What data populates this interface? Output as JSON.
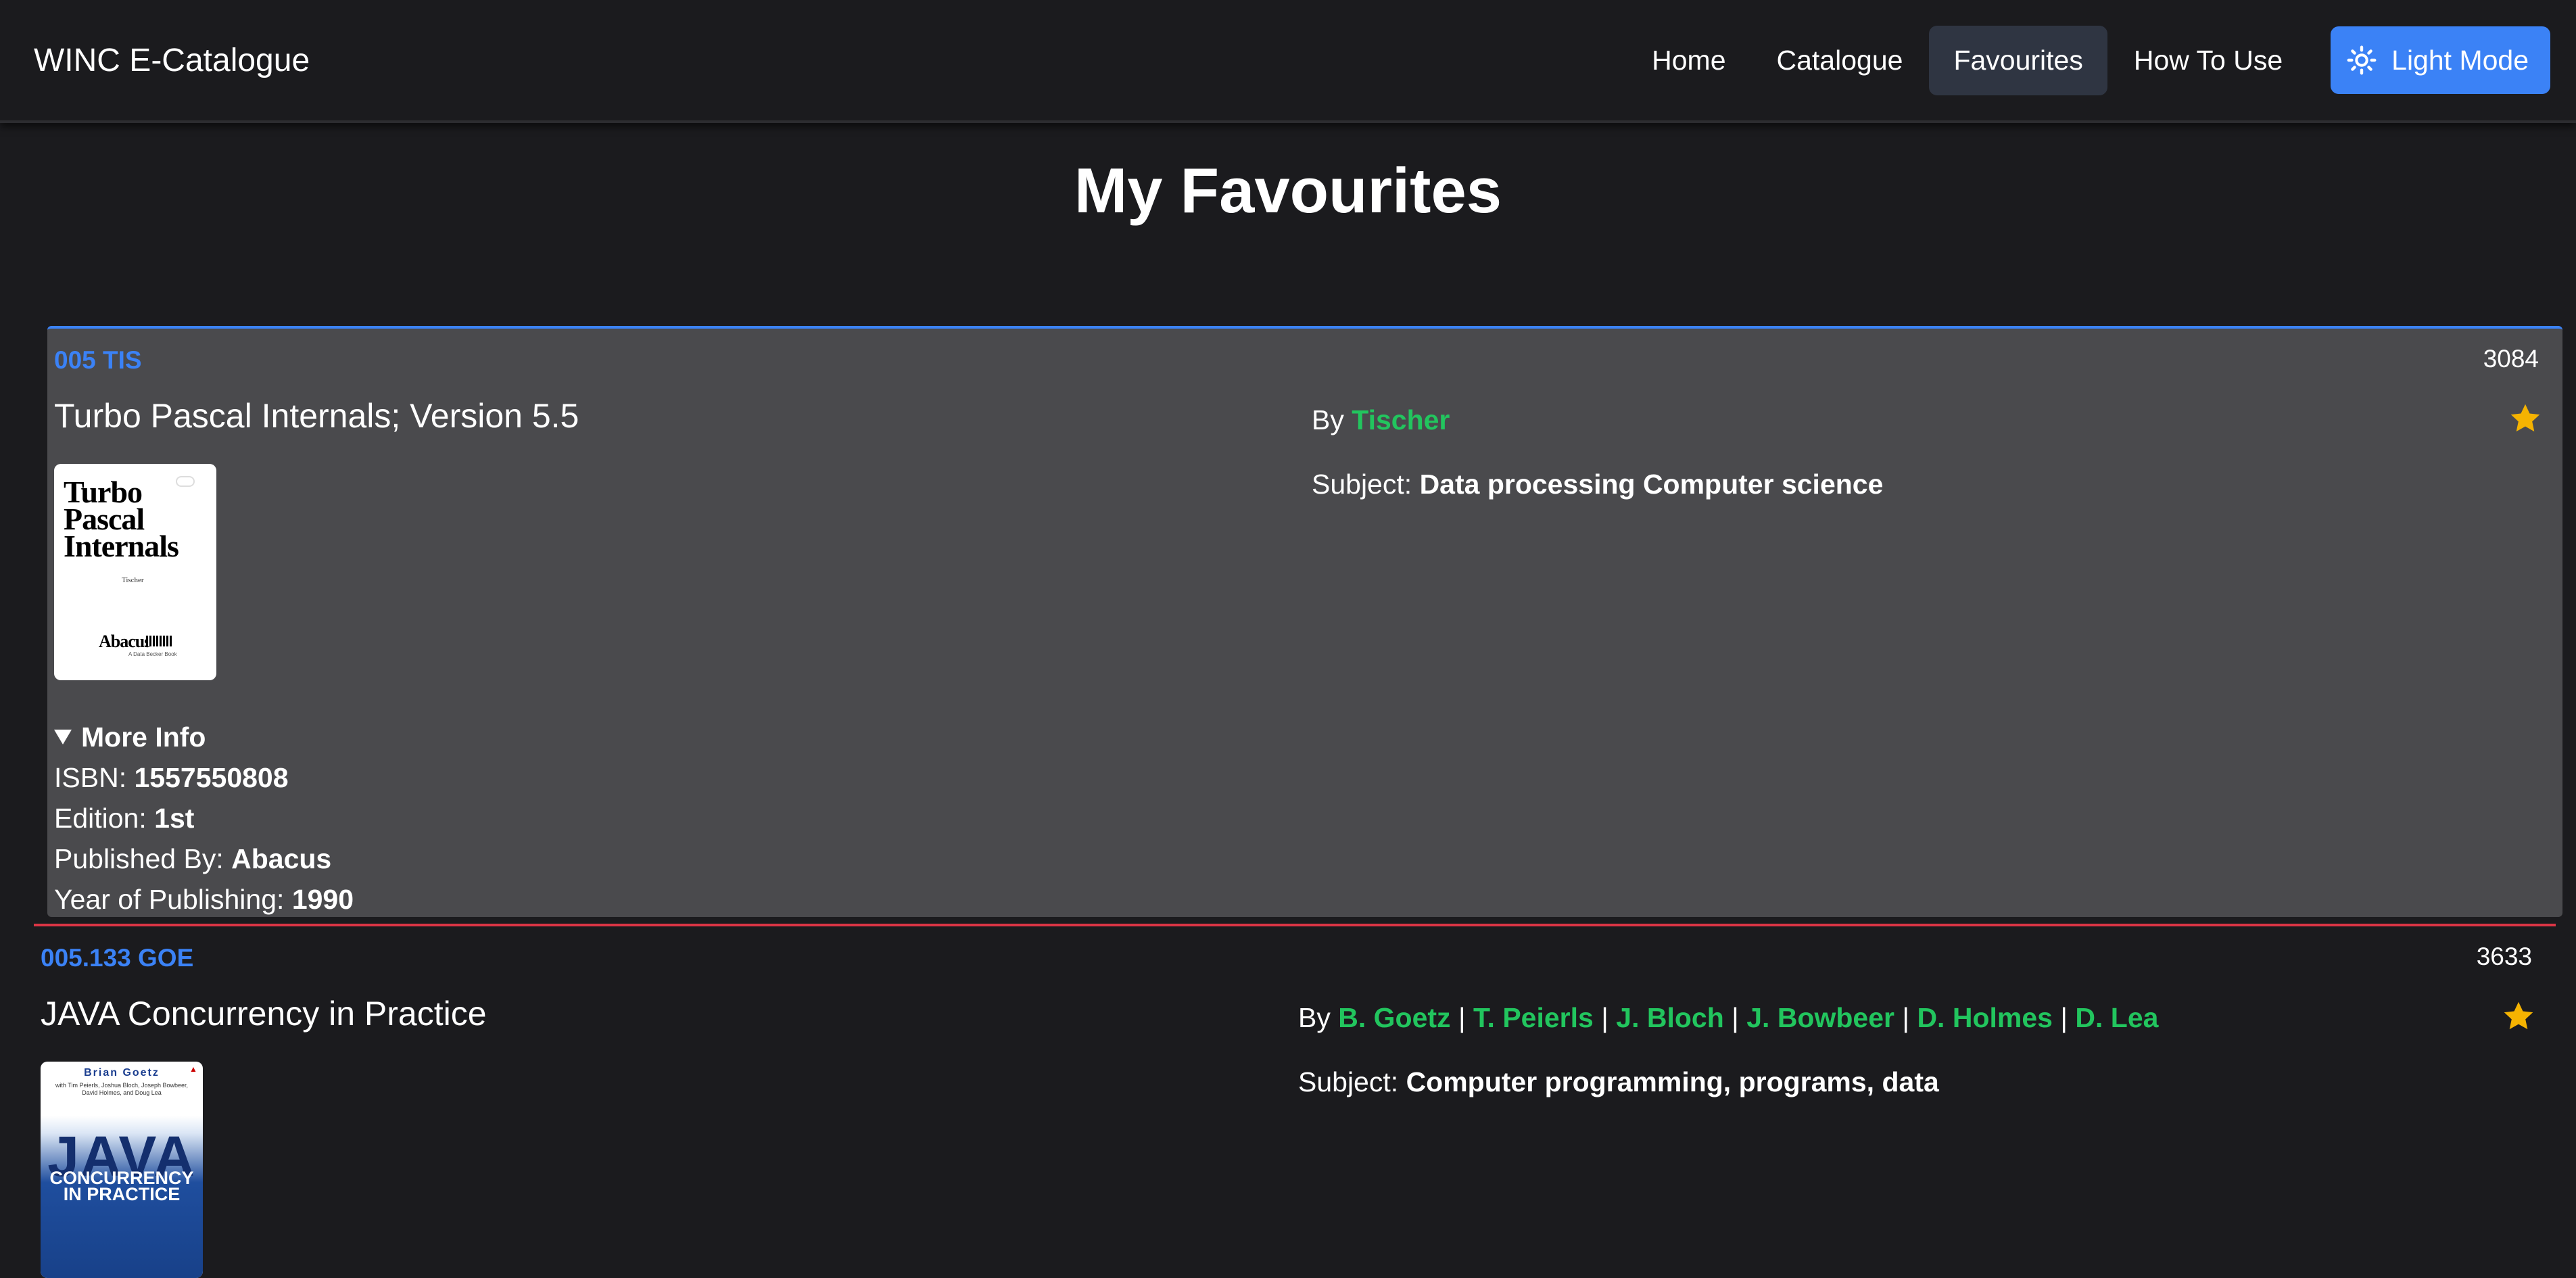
{
  "nav": {
    "brand": "WINC E-Catalogue",
    "links": [
      "Home",
      "Catalogue",
      "Favourites",
      "How To Use"
    ],
    "active": "Favourites",
    "theme_button": "Light Mode"
  },
  "page_title": "My Favourites",
  "colors": {
    "background": "#1b1b1e",
    "accent_blue": "#3b82f6",
    "author_green": "#22c55e",
    "star_gold": "#f5b301",
    "card_border_red": "#dc3545"
  },
  "books": [
    {
      "call_number": "005 TIS",
      "accession": "3084",
      "title": "Turbo Pascal Internals; Version 5.5",
      "by_label": "By",
      "authors": [
        "Tischer"
      ],
      "subject_label": "Subject:",
      "subject": "Data processing Computer science",
      "favourite_icon": "star-icon",
      "cover": {
        "title_lines": [
          "Turbo",
          "Pascal",
          "Internals"
        ],
        "author": "Tischer",
        "publisher": "Abacus",
        "publisher_sub": "A Data Becker Book"
      },
      "more_info": {
        "label": "More Info",
        "isbn_label": "ISBN:",
        "isbn": "1557550808",
        "edition_label": "Edition:",
        "edition": "1st",
        "publisher_label": "Published By:",
        "publisher": "Abacus",
        "year_label": "Year of Publishing:",
        "year": "1990"
      }
    },
    {
      "call_number": "005.133 GOE",
      "accession": "3633",
      "title": "JAVA Concurrency in Practice",
      "by_label": "By",
      "authors": [
        "B. Goetz",
        "T. Peierls",
        "J. Bloch",
        "J. Bowbeer",
        "D. Holmes",
        "D. Lea"
      ],
      "subject_label": "Subject:",
      "subject": "Computer programming, programs, data",
      "favourite_icon": "star-icon",
      "cover": {
        "author": "Brian Goetz",
        "contributors": "with Tim Peierls, Joshua Bloch, Joseph Bowbeer, David Holmes, and Doug Lea",
        "big": "JAVA",
        "sub_lines": [
          "CONCURRENCY",
          "IN PRACTICE"
        ]
      }
    }
  ]
}
